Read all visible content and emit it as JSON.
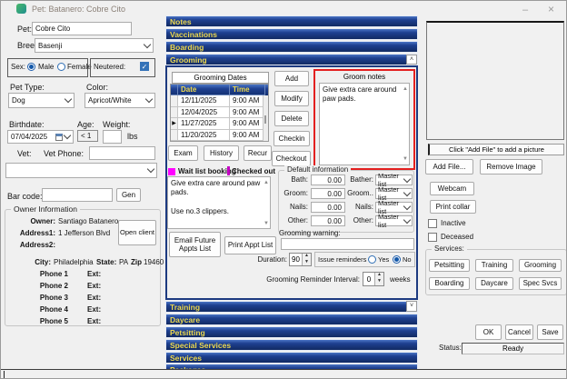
{
  "window": {
    "title": "Pet: Batanero: Cobre Cito",
    "minimize": "–",
    "close": "×"
  },
  "left": {
    "pet_label": "Pet:",
    "pet_value": "Cobre Cito",
    "breed_label": "Breed:",
    "breed_value": "Basenji",
    "sex_label": "Sex:",
    "male_label": "Male",
    "female_label": "Female",
    "neutered_label": "Neutered:",
    "pet_type_label": "Pet Type:",
    "pet_type_value": "Dog",
    "color_label": "Color:",
    "color_value": "Apricot/White",
    "birthdate_label": "Birthdate:",
    "birthdate_value": "07/04/2025",
    "age_label": "Age:",
    "age_value": "< 1",
    "weight_label": "Weight:",
    "weight_value": "",
    "weight_unit": "lbs",
    "vet_label": "Vet:",
    "vet_value": "",
    "vet_phone_label": "Vet Phone:",
    "vet_phone_value": "",
    "barcode_label": "Bar code:",
    "barcode_value": "",
    "gen_button": "Gen",
    "owner": {
      "box_title": "Owner Information",
      "owner_label": "Owner:",
      "owner_value": "Santiago Batanero",
      "address1_label": "Address1:",
      "address1_value": "1 Jefferson Blvd",
      "address2_label": "Address2:",
      "address2_value": "",
      "open_client_button": "Open client",
      "city_label": "City:",
      "city_value": "Philadelphia",
      "state_label": "State:",
      "state_value": "PA",
      "zip_label": "Zip",
      "zip_value": "19460",
      "phones": [
        {
          "label": "Phone 1",
          "ext_label": "Ext:"
        },
        {
          "label": "Phone 2",
          "ext_label": "Ext:"
        },
        {
          "label": "Phone 3",
          "ext_label": "Ext:"
        },
        {
          "label": "Phone 4",
          "ext_label": "Ext:"
        },
        {
          "label": "Phone 5",
          "ext_label": "Ext:"
        }
      ]
    }
  },
  "sections": {
    "top": [
      "Notes",
      "Vaccinations",
      "Boarding",
      "Grooming"
    ],
    "bottom": [
      "Training",
      "Daycare",
      "Petsitting",
      "Special Services",
      "Services",
      "Packages"
    ]
  },
  "grooming": {
    "dates_title": "Grooming Dates",
    "table": {
      "columns": [
        "Date",
        "Time"
      ],
      "rows": [
        [
          "12/11/2025",
          "9:00 AM"
        ],
        [
          "12/04/2025",
          "9:00 AM"
        ],
        [
          "11/27/2025",
          "9:00 AM"
        ],
        [
          "11/20/2025",
          "9:00 AM"
        ]
      ]
    },
    "add_button": "Add",
    "modify_button": "Modify",
    "delete_button": "Delete",
    "checkin_button": "Checkin",
    "checkout_button": "Checkout",
    "exam_button": "Exam",
    "history_button": "History",
    "recur_button": "Recur",
    "wait_list_label": "Wait list booking",
    "checked_out_label": "Checked out",
    "notes_value": "Give extra care around paw pads.\n\nUse no.3 clippers.",
    "email_future_button": "Email Future Appts List",
    "print_appt_button": "Print Appt List",
    "groom_notes_title": "Groom notes",
    "groom_notes_value": "Give extra care around paw pads.",
    "default_info_title": "Default information",
    "default_rows": [
      {
        "price_label": "Bath:",
        "price": "0.00",
        "staff_label": "Bather:",
        "staff": "Master list"
      },
      {
        "price_label": "Groom:",
        "price": "0.00",
        "staff_label": "Groom..",
        "staff": "Master list"
      },
      {
        "price_label": "Nails:",
        "price": "0.00",
        "staff_label": "Nails:",
        "staff": "Master list"
      },
      {
        "price_label": "Other:",
        "price": "0.00",
        "staff_label": "Other:",
        "staff": "Master list"
      }
    ],
    "warning_label": "Grooming warning:",
    "warning_value": "",
    "duration_label": "Duration:",
    "duration_value": "90",
    "reminders_label": "Issue reminders",
    "yes_label": "Yes",
    "no_label": "No",
    "interval_label": "Grooming Reminder Interval:",
    "interval_value": "0",
    "interval_unit": "weeks"
  },
  "right": {
    "picture_hint": "Click \"Add File\" to add a picture",
    "add_file_button": "Add File...",
    "remove_image_button": "Remove Image",
    "webcam_button": "Webcam",
    "print_collar_button": "Print collar",
    "inactive_label": "Inactive",
    "deceased_label": "Deceased",
    "services_title": "Services:",
    "service_buttons": [
      "Petsitting",
      "Training",
      "Grooming",
      "Boarding",
      "Daycare",
      "Spec Svcs"
    ],
    "ok_button": "OK",
    "cancel_button": "Cancel",
    "save_button": "Save",
    "status_label": "Status:",
    "status_value": "Ready"
  },
  "colors": {
    "header_blue": "#1e4090",
    "header_text": "#ecd84e",
    "red_border": "#e32020",
    "magenta": "#ff00ff",
    "accent_blue": "#3472b8"
  }
}
